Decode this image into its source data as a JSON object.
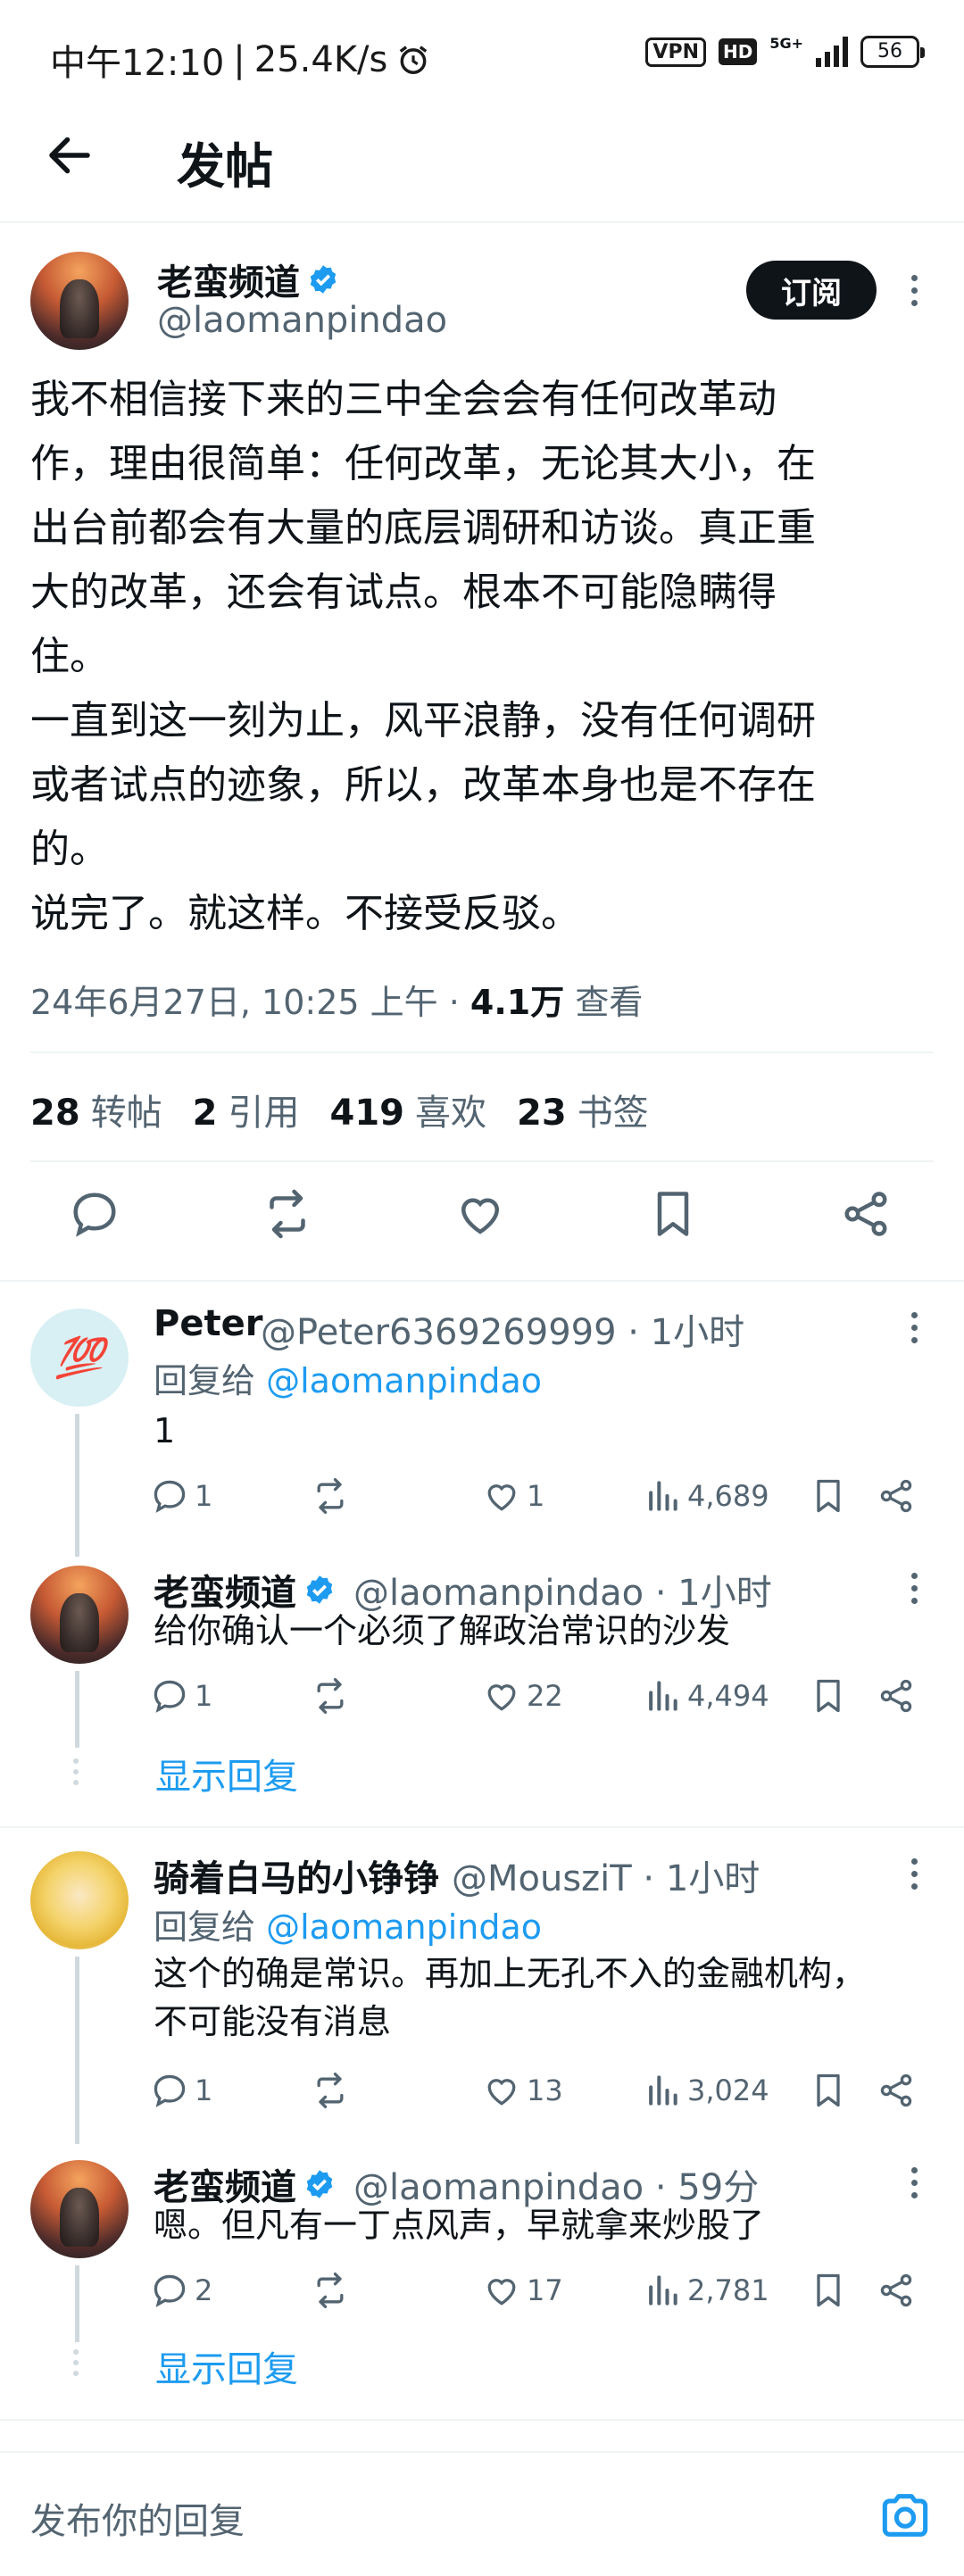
{
  "status_bar": {
    "time": "中午12:10",
    "separator": "|",
    "network_speed": "25.4K/s",
    "vpn": "VPN",
    "hd": "HD",
    "network": "5G+",
    "battery": "56"
  },
  "header": {
    "title": "发帖"
  },
  "post": {
    "author_name": "老蛮频道",
    "author_handle": "@laomanpindao",
    "subscribe_label": "订阅",
    "text": "我不相信接下来的三中全会会有任何改革动\n作，理由很简单：任何改革，无论其大小，在\n出台前都会有大量的底层调研和访谈。真正重\n大的改革，还会有试点。根本不可能隐瞒得\n住。\n一直到这一刻为止，风平浪静，没有任何调研\n或者试点的迹象，所以，改革本身也是不存在\n的。\n说完了。就这样。不接受反驳。",
    "timestamp": "24年6月27日, 10:25 上午 ·",
    "views_count": "4.1万",
    "views_label": "查看",
    "stats": [
      {
        "count": "28",
        "label": "转帖"
      },
      {
        "count": "2",
        "label": "引用"
      },
      {
        "count": "419",
        "label": "喜欢"
      },
      {
        "count": "23",
        "label": "书签"
      }
    ]
  },
  "replies": [
    {
      "name": "Peter",
      "handle": "@Peter6369269999 · 1小时",
      "reply_to_label": "回复给",
      "reply_to": "@laomanpindao",
      "text": "1",
      "comments": "1",
      "likes": "1",
      "views": "4,689"
    },
    {
      "name": "老蛮频道",
      "handle": "@laomanpindao · 1小时",
      "text": "给你确认一个必须了解政治常识的沙发",
      "comments": "1",
      "likes": "22",
      "views": "4,494",
      "show_replies": "显示回复"
    },
    {
      "name": "骑着白马的小铮铮",
      "handle": "@MousziT · 1小时",
      "reply_to_label": "回复给",
      "reply_to": "@laomanpindao",
      "text": "这个的确是常识。再加上无孔不入的金融机构，\n不可能没有消息",
      "comments": "1",
      "likes": "13",
      "views": "3,024"
    },
    {
      "name": "老蛮频道",
      "handle": "@laomanpindao · 59分",
      "text": "嗯。但凡有一丁点风声，早就拿来炒股了",
      "comments": "2",
      "likes": "17",
      "views": "2,781",
      "show_replies": "显示回复"
    }
  ],
  "compose": {
    "placeholder": "发布你的回复"
  },
  "colors": {
    "accent": "#1d9bf0",
    "text": "#0f1419",
    "muted": "#536471",
    "line": "#cfd9de"
  },
  "icons": [
    "back-arrow-icon",
    "verified-badge-icon",
    "more-icon",
    "reply-icon",
    "repost-icon",
    "like-icon",
    "bookmark-icon",
    "share-icon",
    "views-icon",
    "camera-icon"
  ]
}
